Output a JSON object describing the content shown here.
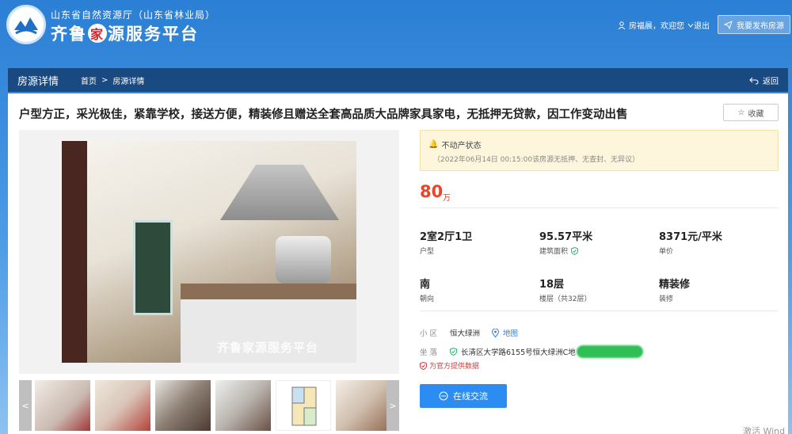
{
  "header": {
    "org_name": "山东省自然资源厅（山东省林业局）",
    "site_name_part1": "齐鲁",
    "site_name_mark": "家",
    "site_name_part2": "源服务平台",
    "user_greeting": "房福晨，欢迎您",
    "logout": "退出",
    "publish_label": "我要发布房源"
  },
  "nav": {
    "title": "房源详情",
    "breadcrumb": [
      "首页",
      "房源详情"
    ],
    "breadcrumb_sep": ">",
    "back_label": "返回"
  },
  "listing": {
    "title": "户型方正，采光极佳，紧靠学校，接送方便，精装修且赠送全套高品质大品牌家具家电，无抵押无贷款，因工作变动出售",
    "favorite_label": "收藏",
    "watermark": "齐鲁家源服务平台",
    "status_title": "不动产状态",
    "status_detail": "（2022年06月14日 00:15:00该房源无抵押、无查封、无异议）",
    "price": "80",
    "price_unit": "万",
    "layout_value": "2室2厅1卫",
    "layout_label": "户型",
    "area_value": "95.57平米",
    "area_label": "建筑面积",
    "unit_price_value": "8371元/平米",
    "unit_price_label": "单价",
    "orientation_value": "南",
    "orientation_label": "朝向",
    "floor_value": "18层",
    "floor_label": "楼层（共32层）",
    "decoration_value": "精装修",
    "decoration_label": "装修",
    "community_label": "小 区",
    "community_value": "恒大绿洲",
    "map_label": "地图",
    "address_label": "坐 落",
    "address_value": "长清区大学路6155号恒大绿洲C地",
    "official_label": "为官方提供数据",
    "chat_label": "在线交流"
  },
  "thumbs": {
    "prev": "<",
    "next": ">"
  },
  "system": {
    "windows_mark": "激活 Wind"
  },
  "colors": {
    "accent": "#2b8cf2",
    "price": "#e8452a",
    "nav_bg": "#143c6e"
  }
}
